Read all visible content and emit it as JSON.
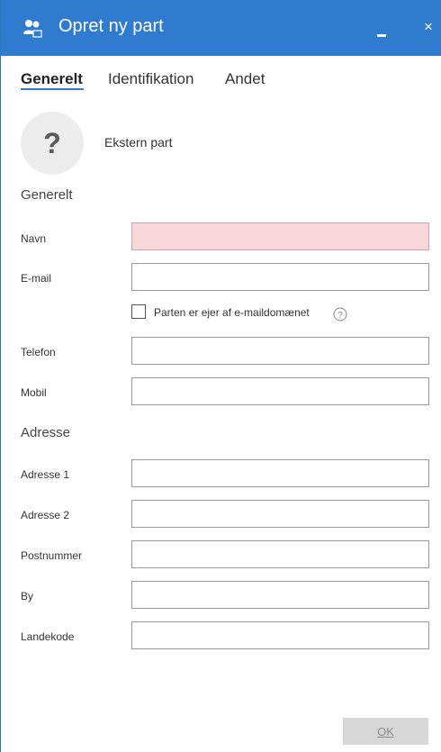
{
  "window": {
    "title": "Opret ny part",
    "close_glyph": "×",
    "accent_color": "#2f7bd0",
    "title_icon": "users-icon"
  },
  "tabs": [
    {
      "label": "Generelt",
      "active": true
    },
    {
      "label": "Identifikation",
      "active": false
    },
    {
      "label": "Andet",
      "active": false
    }
  ],
  "party": {
    "avatar_glyph": "?",
    "type_label": "Ekstern part"
  },
  "sections": {
    "general": "Generelt",
    "address": "Adresse"
  },
  "fields": {
    "navn": {
      "label": "Navn",
      "value": "",
      "required": true
    },
    "email": {
      "label": "E-mail",
      "value": ""
    },
    "telefon": {
      "label": "Telefon",
      "value": ""
    },
    "mobil": {
      "label": "Mobil",
      "value": ""
    },
    "adresse1": {
      "label": "Adresse 1",
      "value": ""
    },
    "adresse2": {
      "label": "Adresse 2",
      "value": ""
    },
    "postnummer": {
      "label": "Postnummer",
      "value": ""
    },
    "by": {
      "label": "By",
      "value": ""
    },
    "landekode": {
      "label": "Landekode",
      "value": ""
    }
  },
  "email_domain_owner": {
    "label": "Parten er ejer af e-maildomænet",
    "checked": false,
    "help_icon": "question-circle-icon"
  },
  "footer": {
    "ok_label": "OK",
    "ok_disabled": true
  }
}
